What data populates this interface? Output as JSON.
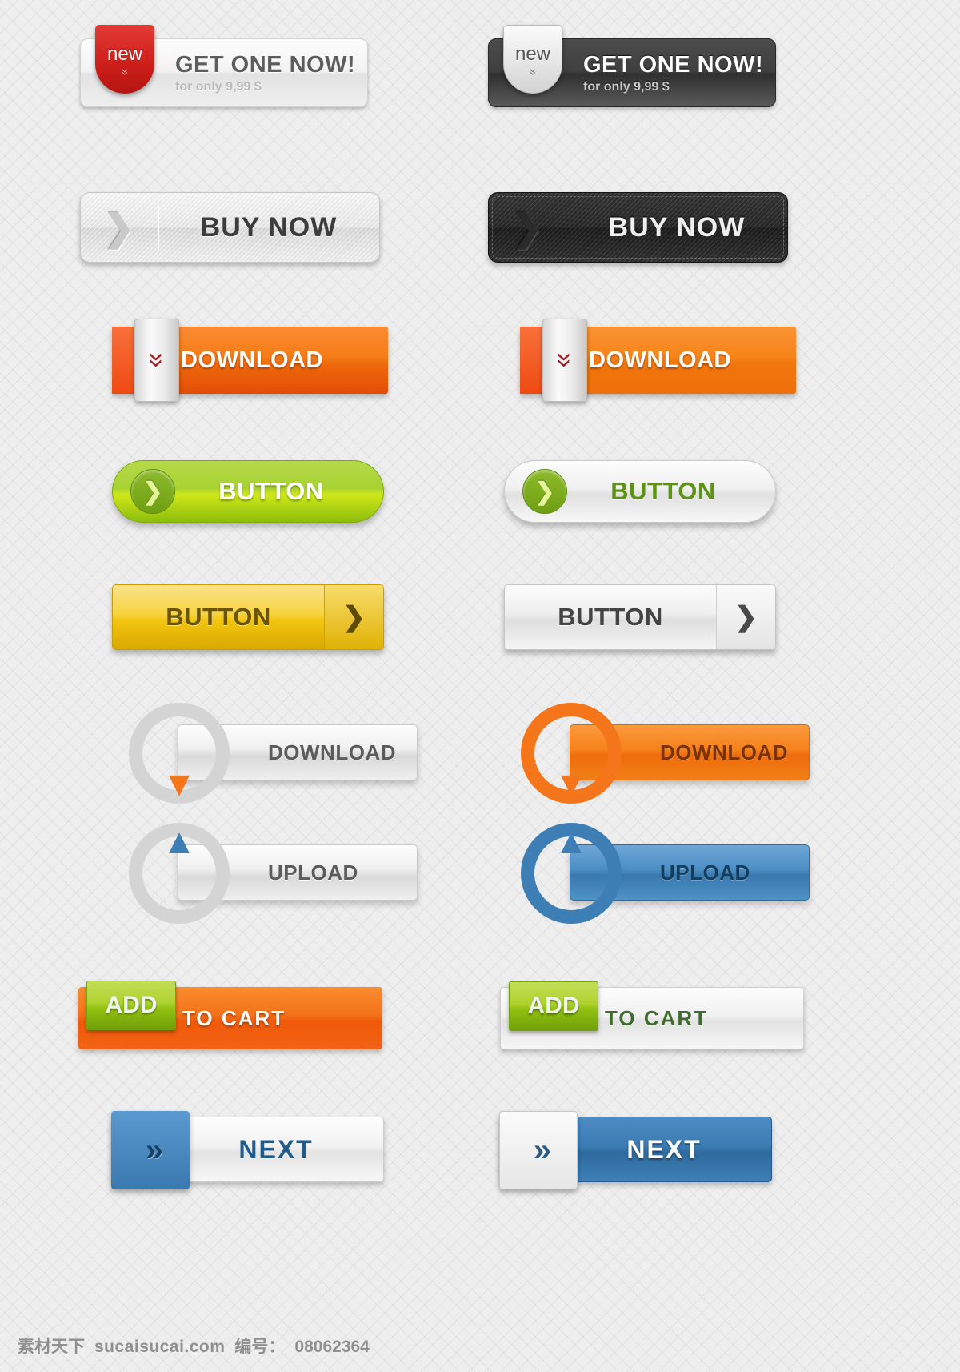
{
  "rows": [
    {
      "id": "get-one-now",
      "left": {
        "badge": "new",
        "badge_chevron": "»",
        "title": "GET ONE NOW!",
        "subtitle": "for only 9,99 $",
        "theme": "light"
      },
      "right": {
        "badge": "new",
        "badge_chevron": "»",
        "title": "GET ONE NOW!",
        "subtitle": "for only 9,99 $",
        "theme": "dark"
      }
    },
    {
      "id": "buy-now",
      "left": {
        "label": "BUY NOW",
        "chevron": "❯",
        "theme": "light"
      },
      "right": {
        "label": "BUY NOW",
        "chevron": "❯",
        "theme": "dark"
      }
    },
    {
      "id": "download-tab",
      "left": {
        "label": "DOWNLOAD",
        "tab_chevron": "»",
        "theme": "orange-red"
      },
      "right": {
        "label": "DOWNLOAD",
        "tab_chevron": "»",
        "theme": "orange"
      }
    },
    {
      "id": "pill-button",
      "left": {
        "label": "BUTTON",
        "circle_chevron": "❯",
        "theme": "green"
      },
      "right": {
        "label": "BUTTON",
        "circle_chevron": "❯",
        "theme": "silver"
      }
    },
    {
      "id": "arrow-button",
      "left": {
        "label": "BUTTON",
        "arrow": "❯",
        "theme": "yellow"
      },
      "right": {
        "label": "BUTTON",
        "arrow": "❯",
        "theme": "silver"
      }
    },
    {
      "id": "download-ring",
      "left": {
        "label": "DOWNLOAD",
        "arrow_tip": "▼",
        "theme": "silver"
      },
      "right": {
        "label": "DOWNLOAD",
        "arrow_tip": "▼",
        "theme": "orange"
      }
    },
    {
      "id": "upload-ring",
      "left": {
        "label": "UPLOAD",
        "arrow_tip": "▲",
        "theme": "silver"
      },
      "right": {
        "label": "UPLOAD",
        "arrow_tip": "▲",
        "theme": "blue"
      }
    },
    {
      "id": "add-to-cart",
      "left": {
        "tab_label": "ADD",
        "label": "TO  CART",
        "theme": "orange"
      },
      "right": {
        "tab_label": "ADD",
        "label": "TO  CART",
        "theme": "silver"
      }
    },
    {
      "id": "next",
      "left": {
        "label": "NEXT",
        "tab_chevron": "»",
        "theme": "silver-bar"
      },
      "right": {
        "label": "NEXT",
        "tab_chevron": "»",
        "theme": "blue-bar"
      }
    }
  ],
  "footer": {
    "brand": "素材天下",
    "site": "sucaisucai.com",
    "id_label": "编号：",
    "id_value": "08062364"
  },
  "colors": {
    "orange": "#f4751a",
    "red": "#cf1f1b",
    "green": "#a8d232",
    "yellow": "#f7d33f",
    "blue": "#3d7fb5",
    "silver": "#e6e6e6",
    "dark": "#333333"
  }
}
